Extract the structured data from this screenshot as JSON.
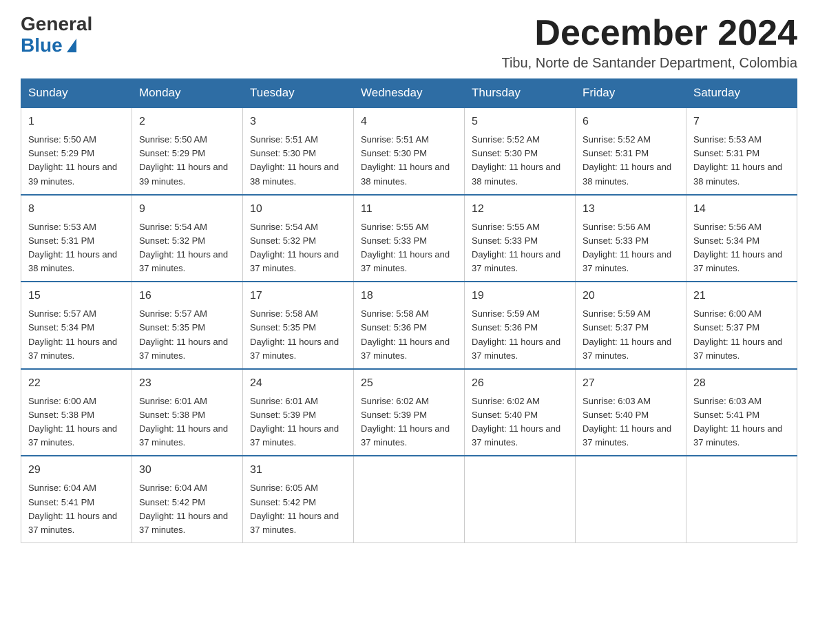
{
  "logo": {
    "general": "General",
    "blue": "Blue"
  },
  "header": {
    "title": "December 2024",
    "subtitle": "Tibu, Norte de Santander Department, Colombia"
  },
  "weekdays": [
    "Sunday",
    "Monday",
    "Tuesday",
    "Wednesday",
    "Thursday",
    "Friday",
    "Saturday"
  ],
  "weeks": [
    [
      {
        "day": "1",
        "sunrise": "5:50 AM",
        "sunset": "5:29 PM",
        "daylight": "11 hours and 39 minutes."
      },
      {
        "day": "2",
        "sunrise": "5:50 AM",
        "sunset": "5:29 PM",
        "daylight": "11 hours and 39 minutes."
      },
      {
        "day": "3",
        "sunrise": "5:51 AM",
        "sunset": "5:30 PM",
        "daylight": "11 hours and 38 minutes."
      },
      {
        "day": "4",
        "sunrise": "5:51 AM",
        "sunset": "5:30 PM",
        "daylight": "11 hours and 38 minutes."
      },
      {
        "day": "5",
        "sunrise": "5:52 AM",
        "sunset": "5:30 PM",
        "daylight": "11 hours and 38 minutes."
      },
      {
        "day": "6",
        "sunrise": "5:52 AM",
        "sunset": "5:31 PM",
        "daylight": "11 hours and 38 minutes."
      },
      {
        "day": "7",
        "sunrise": "5:53 AM",
        "sunset": "5:31 PM",
        "daylight": "11 hours and 38 minutes."
      }
    ],
    [
      {
        "day": "8",
        "sunrise": "5:53 AM",
        "sunset": "5:31 PM",
        "daylight": "11 hours and 38 minutes."
      },
      {
        "day": "9",
        "sunrise": "5:54 AM",
        "sunset": "5:32 PM",
        "daylight": "11 hours and 37 minutes."
      },
      {
        "day": "10",
        "sunrise": "5:54 AM",
        "sunset": "5:32 PM",
        "daylight": "11 hours and 37 minutes."
      },
      {
        "day": "11",
        "sunrise": "5:55 AM",
        "sunset": "5:33 PM",
        "daylight": "11 hours and 37 minutes."
      },
      {
        "day": "12",
        "sunrise": "5:55 AM",
        "sunset": "5:33 PM",
        "daylight": "11 hours and 37 minutes."
      },
      {
        "day": "13",
        "sunrise": "5:56 AM",
        "sunset": "5:33 PM",
        "daylight": "11 hours and 37 minutes."
      },
      {
        "day": "14",
        "sunrise": "5:56 AM",
        "sunset": "5:34 PM",
        "daylight": "11 hours and 37 minutes."
      }
    ],
    [
      {
        "day": "15",
        "sunrise": "5:57 AM",
        "sunset": "5:34 PM",
        "daylight": "11 hours and 37 minutes."
      },
      {
        "day": "16",
        "sunrise": "5:57 AM",
        "sunset": "5:35 PM",
        "daylight": "11 hours and 37 minutes."
      },
      {
        "day": "17",
        "sunrise": "5:58 AM",
        "sunset": "5:35 PM",
        "daylight": "11 hours and 37 minutes."
      },
      {
        "day": "18",
        "sunrise": "5:58 AM",
        "sunset": "5:36 PM",
        "daylight": "11 hours and 37 minutes."
      },
      {
        "day": "19",
        "sunrise": "5:59 AM",
        "sunset": "5:36 PM",
        "daylight": "11 hours and 37 minutes."
      },
      {
        "day": "20",
        "sunrise": "5:59 AM",
        "sunset": "5:37 PM",
        "daylight": "11 hours and 37 minutes."
      },
      {
        "day": "21",
        "sunrise": "6:00 AM",
        "sunset": "5:37 PM",
        "daylight": "11 hours and 37 minutes."
      }
    ],
    [
      {
        "day": "22",
        "sunrise": "6:00 AM",
        "sunset": "5:38 PM",
        "daylight": "11 hours and 37 minutes."
      },
      {
        "day": "23",
        "sunrise": "6:01 AM",
        "sunset": "5:38 PM",
        "daylight": "11 hours and 37 minutes."
      },
      {
        "day": "24",
        "sunrise": "6:01 AM",
        "sunset": "5:39 PM",
        "daylight": "11 hours and 37 minutes."
      },
      {
        "day": "25",
        "sunrise": "6:02 AM",
        "sunset": "5:39 PM",
        "daylight": "11 hours and 37 minutes."
      },
      {
        "day": "26",
        "sunrise": "6:02 AM",
        "sunset": "5:40 PM",
        "daylight": "11 hours and 37 minutes."
      },
      {
        "day": "27",
        "sunrise": "6:03 AM",
        "sunset": "5:40 PM",
        "daylight": "11 hours and 37 minutes."
      },
      {
        "day": "28",
        "sunrise": "6:03 AM",
        "sunset": "5:41 PM",
        "daylight": "11 hours and 37 minutes."
      }
    ],
    [
      {
        "day": "29",
        "sunrise": "6:04 AM",
        "sunset": "5:41 PM",
        "daylight": "11 hours and 37 minutes."
      },
      {
        "day": "30",
        "sunrise": "6:04 AM",
        "sunset": "5:42 PM",
        "daylight": "11 hours and 37 minutes."
      },
      {
        "day": "31",
        "sunrise": "6:05 AM",
        "sunset": "5:42 PM",
        "daylight": "11 hours and 37 minutes."
      },
      null,
      null,
      null,
      null
    ]
  ]
}
